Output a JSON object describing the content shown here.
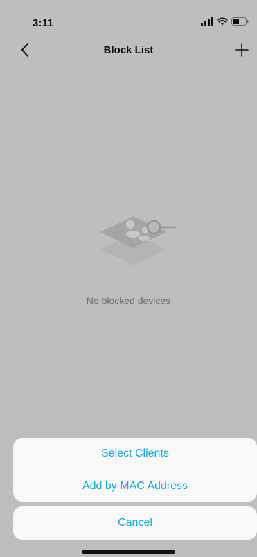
{
  "status_bar": {
    "time": "3:11",
    "icons": [
      "signal-icon",
      "wifi-icon",
      "battery-icon"
    ]
  },
  "nav": {
    "title": "Block List",
    "back_icon": "chevron-left-icon",
    "add_icon": "plus-icon"
  },
  "empty_state": {
    "icon": "devices-search-icon",
    "message": "No blocked devices"
  },
  "action_sheet": {
    "options": [
      {
        "label": "Select Clients"
      },
      {
        "label": "Add by MAC Address"
      }
    ],
    "cancel_label": "Cancel"
  },
  "colors": {
    "accent": "#1aa6d3",
    "background": "#f4f4f4",
    "sheet": "#f8f8f8"
  }
}
